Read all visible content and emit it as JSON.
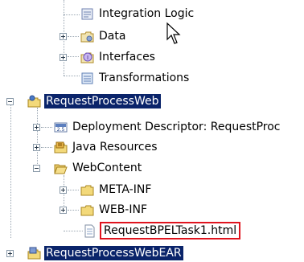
{
  "tree": {
    "items": [
      {
        "label": "Integration Logic",
        "icon": "integration-logic-icon"
      },
      {
        "label": "Data",
        "icon": "data-folder-icon"
      },
      {
        "label": "Interfaces",
        "icon": "interfaces-icon"
      },
      {
        "label": "Transformations",
        "icon": "transformations-icon"
      },
      {
        "label": "RequestProcessWeb",
        "icon": "web-project-icon"
      },
      {
        "label": "Deployment Descriptor: RequestProc",
        "icon": "deployment-descriptor-icon"
      },
      {
        "label": "Java Resources",
        "icon": "java-resources-icon"
      },
      {
        "label": "WebContent",
        "icon": "open-folder-icon"
      },
      {
        "label": "META-INF",
        "icon": "folder-icon"
      },
      {
        "label": "WEB-INF",
        "icon": "folder-icon"
      },
      {
        "label": "RequestBPELTask1.html",
        "icon": "html-file-icon"
      },
      {
        "label": "RequestProcessWebEAR",
        "icon": "ear-project-icon"
      }
    ]
  },
  "colors": {
    "selection": "#0a246a",
    "highlight_box": "#e0141e"
  }
}
